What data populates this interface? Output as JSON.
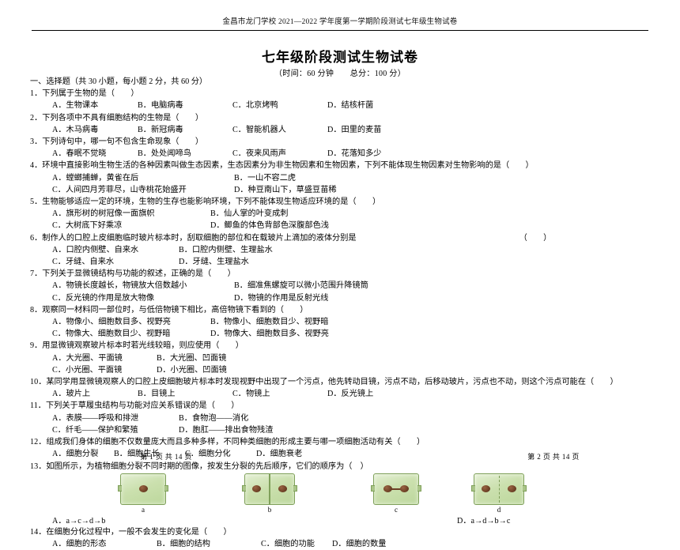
{
  "header": {
    "running_head": "金昌市龙门学校 2021—2022 学年度第一学期阶段测试七年级生物试卷",
    "title": "七年级阶段测试生物试卷",
    "subtitle": "（时间：60 分钟　　总分：100 分）"
  },
  "section": {
    "heading": "一、选择题（共 30 小题，每小题 2 分，共 60 分）"
  },
  "questions": [
    {
      "number": "1．",
      "stem": "下列属于生物的是（　　）",
      "options": [
        "A．生物课本",
        "B．电脑病毒",
        "C．北京烤鸭",
        "D．结核杆菌"
      ],
      "layout": "four-inline"
    },
    {
      "number": "2．",
      "stem": "下列各项中不具有细胞结构的生物是（　　）",
      "options": [
        "A．木马病毒",
        "B．新冠病毒",
        "C．智能机器人",
        "D．田里的麦苗"
      ],
      "layout": "four-inline"
    },
    {
      "number": "3．",
      "stem": "下列诗句中，哪一句不包含生命现象（　　）",
      "options": [
        "A．春眠不觉晓",
        "B．处处闻啼鸟",
        "C．夜来风雨声",
        "D．花落知多少"
      ],
      "layout": "four-inline"
    },
    {
      "number": "4．",
      "stem": "环境中直接影响生物生活的各种因素叫做生态因素，生态因素分为非生物因素和生物因素，下列不能体现生物因素对生物影响的是（　　）",
      "options": [
        "A．螳螂捕蝉，黄雀在后",
        "B．一山不容二虎",
        "C．人间四月芳菲尽，山寺桃花始盛开",
        "D．种豆南山下，草盛豆苗稀"
      ],
      "layout": "two-by-two-wide"
    },
    {
      "number": "5．",
      "stem": "生物能够适应一定的环境，生物的生存也能影响环境，下列不能体现生物适应环境的是（　　）",
      "options": [
        "A．旗形树的树冠像一面旗帜",
        "B．仙人掌的叶变成刺",
        "C．大树底下好乘凉",
        "D．鲫鱼的体色背部色深腹部色浅"
      ],
      "layout": "two-by-two"
    },
    {
      "number": "6．",
      "stem": "制作人的口腔上皮细胞临时玻片标本时，刮取细胞的部位和在载玻片上滴加的液体分别是",
      "stem_tail": "（　　）",
      "options": [
        "A．口腔内侧壁、自来水",
        "B．口腔内侧壁、生理盐水",
        "C．牙缝、自来水",
        "D．牙缝、生理盐水"
      ],
      "layout": "two-by-two"
    },
    {
      "number": "7．",
      "stem": "下列关于显微镜结构与功能的叙述，正确的是（　　）",
      "options": [
        "A．物镜长度越长，物镜放大倍数越小",
        "B．细准焦螺旋可以微小范围升降镜筒",
        "C．反光镜的作用是放大物像",
        "D．物镜的作用是反射光线"
      ],
      "layout": "two-by-two"
    },
    {
      "number": "8．",
      "stem": "观察同一材料同一部位时，与低倍物镜下相比，高倍物镜下看到的（　　）",
      "options": [
        "A．物像小、细胞数目多、视野亮",
        "B．物像小、细胞数目少、视野暗",
        "C．物像大、细胞数目少、视野暗",
        "D．物像大、细胞数目多、视野亮"
      ],
      "layout": "two-by-two"
    },
    {
      "number": "9．",
      "stem": "用显微镜观察玻片标本时若光线较暗，则应使用（　　）",
      "options": [
        "A．大光圈、平面镜",
        "B．大光圈、凹面镜",
        "C．小光圈、平面镜",
        "D．小光圈、凹面镜"
      ],
      "layout": "two-by-two"
    },
    {
      "number": "10．",
      "stem": "某同学用显微镜观察人的口腔上皮细胞玻片标本时发现视野中出现了一个污点，他先转动目镜，污点不动，后移动玻片，污点也不动，则这个污点可能在（　　）",
      "options": [
        "A．玻片上",
        "B．目镜上",
        "C．物镜上",
        "D．反光镜上"
      ],
      "layout": "four-inline"
    },
    {
      "number": "11．",
      "stem": "下列关于草履虫结构与功能对应关系错误的是（　　）",
      "options": [
        "A．表膜——呼吸和排泄",
        "B．食物泡——消化",
        "C．纤毛——保护和繁殖",
        "D．胞肛——排出食物残渣"
      ],
      "layout": "two-by-two"
    },
    {
      "number": "12．",
      "stem": "组成我们身体的细胞不仅数量庞大而且多种多样，不同种类细胞的形成主要与哪一项细胞活动有关（　　）",
      "options": [
        "A．细胞分裂",
        "B．细胞生长",
        "C．细胞分化",
        "D．细胞衰老"
      ],
      "layout": "four-tight"
    },
    {
      "number": "13．",
      "stem": "如图所示，为植物细胞分裂不同时期的图像，按发生分裂的先后顺序，它们的顺序为（　）",
      "figure_labels": [
        "a",
        "b",
        "c",
        "d"
      ],
      "options": [
        "A．a→c→d→b",
        "D．a→d→b→c"
      ],
      "layout": "figure"
    },
    {
      "number": "14．",
      "stem": "在细胞分化过程中，一般不会发生的变化是（　　）",
      "options": [
        "A．细胞的形态",
        "B．细胞的结构",
        "C．细胞的功能",
        "D．细胞的数量"
      ],
      "layout": "four-inline"
    }
  ],
  "footer": {
    "left": "第 1 页   共 14 页",
    "right": "第 2 页   共 14 页"
  }
}
